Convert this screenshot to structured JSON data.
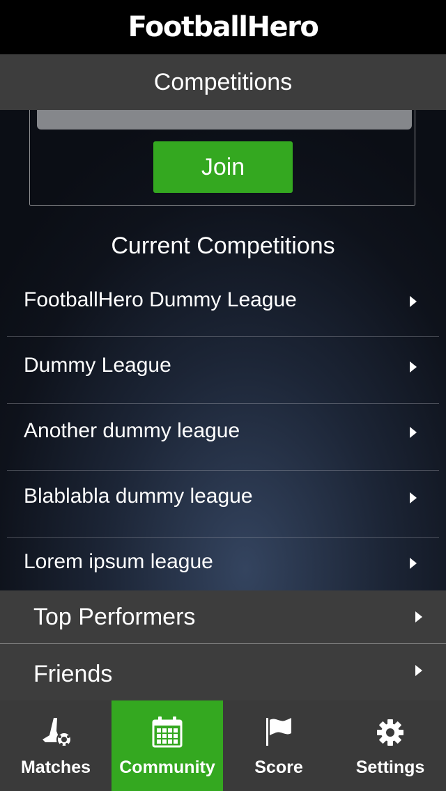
{
  "header": {
    "logo_text": "FootballHero"
  },
  "nav": {
    "title": "Competitions"
  },
  "join_panel": {
    "code_value": "",
    "join_label": "Join"
  },
  "current": {
    "title": "Current Competitions",
    "items": [
      {
        "label": "FootballHero Dummy League"
      },
      {
        "label": "Dummy League"
      },
      {
        "label": "Another dummy league"
      },
      {
        "label": "Blablabla dummy league"
      },
      {
        "label": "Lorem ipsum league"
      }
    ]
  },
  "links": {
    "top_performers": "Top Performers",
    "friends": "Friends"
  },
  "tabs": [
    {
      "label": "Matches",
      "icon": "boot-ball-icon",
      "active": false
    },
    {
      "label": "Community",
      "icon": "calendar-icon",
      "active": true
    },
    {
      "label": "Score",
      "icon": "flag-icon",
      "active": false
    },
    {
      "label": "Settings",
      "icon": "gear-icon",
      "active": false
    }
  ],
  "colors": {
    "accent": "#34a820",
    "bar": "#3d3d3d",
    "tab_bar": "#3a3a3a",
    "logo_bar": "#000000"
  }
}
